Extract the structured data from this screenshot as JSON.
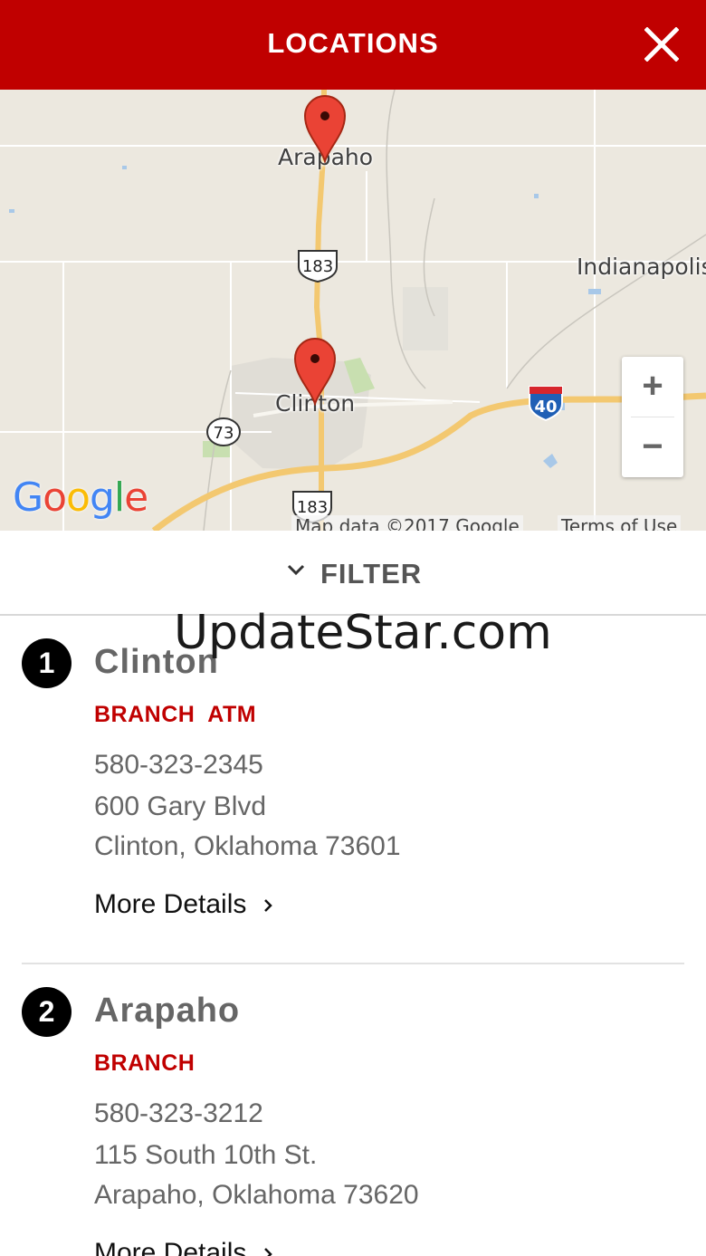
{
  "header": {
    "title": "LOCATIONS",
    "close_icon": "close-icon"
  },
  "map": {
    "labels": {
      "arapaho": "Arapaho",
      "indianapolis": "Indianapolis",
      "clinton": "Clinton"
    },
    "highway_shields": {
      "us183_north": "183",
      "us183_south": "183",
      "i40": "40",
      "sh73": "73"
    },
    "zoom_in": "+",
    "zoom_out": "−",
    "google_logo": "Google",
    "map_data": "Map data ©2017 Google",
    "terms": "Terms of Use",
    "pin_color": "#e74c3c"
  },
  "filter": {
    "label": "FILTER",
    "icon": "chevron-down-icon"
  },
  "watermark": "UpdateStar.com",
  "locations": [
    {
      "number": "1",
      "name": "Clinton",
      "tags": "BRANCH  ATM",
      "phone": "580-323-2345",
      "address1": "600 Gary Blvd",
      "address2": "Clinton, Oklahoma 73601",
      "more": "More Details"
    },
    {
      "number": "2",
      "name": "Arapaho",
      "tags": "BRANCH",
      "phone": "580-323-3212",
      "address1": "115 South 10th St.",
      "address2": "Arapaho, Oklahoma 73620",
      "more": "More Details"
    }
  ],
  "colors": {
    "header": "#c00000",
    "tag": "#c00000",
    "text": "#666666"
  }
}
